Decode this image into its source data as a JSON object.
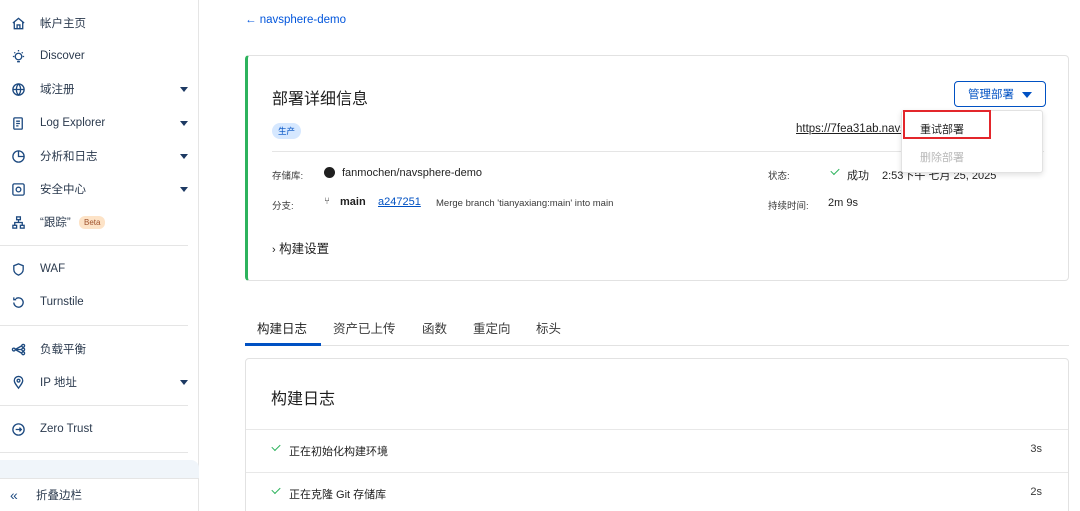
{
  "sidebar": {
    "items": [
      {
        "label": "帐户主页",
        "icon": "home-icon"
      },
      {
        "label": "Discover",
        "icon": "lightbulb-icon"
      },
      {
        "label": "域注册",
        "icon": "globe-icon"
      },
      {
        "label": "Log Explorer",
        "icon": "log-icon"
      },
      {
        "label": "分析和日志",
        "icon": "chart-pie-icon"
      },
      {
        "label": "安全中心",
        "icon": "security-icon"
      },
      {
        "label": "“跟踪”",
        "icon": "trace-icon",
        "badge": "Beta"
      },
      {
        "label": "WAF",
        "icon": "waf-shield-icon"
      },
      {
        "label": "Turnstile",
        "icon": "turnstile-icon"
      },
      {
        "label": "负载平衡",
        "icon": "load-balance-icon"
      },
      {
        "label": "IP 地址",
        "icon": "location-pin-icon"
      },
      {
        "label": "Zero Trust",
        "icon": "zero-trust-icon"
      }
    ],
    "collapse_label": "折叠边栏"
  },
  "breadcrumb": {
    "back_label": "← navsphere-demo"
  },
  "deployment": {
    "title": "部署详细信息",
    "environment_badge": "生产",
    "manage_button": "管理部署",
    "url": "https://7fea31ab.navsphere-demo.pages.dev",
    "repo_label": "存储库:",
    "repo_value": "fanmochen/navsphere-demo",
    "branch_label": "分支:",
    "branch_value": "main",
    "commit_hash": "a247251",
    "commit_message": "Merge branch 'tianyaxiang:main' into main",
    "status_label": "状态:",
    "status_value": "成功",
    "status_time": "2:53下午 七月 25, 2025",
    "duration_label": "持续时间:",
    "duration_value": "2m 9s",
    "build_settings": "构建设置"
  },
  "dropdown": {
    "retry": "重试部署",
    "delete": "删除部署"
  },
  "tabs": [
    {
      "label": "构建日志",
      "active": true
    },
    {
      "label": "资产已上传"
    },
    {
      "label": "函数"
    },
    {
      "label": "重定向"
    },
    {
      "label": "标头"
    }
  ],
  "build_log": {
    "title": "构建日志",
    "rows": [
      {
        "text": "正在初始化构建环境",
        "time": "3s"
      },
      {
        "text": "正在克隆 Git 存储库",
        "time": "2s"
      }
    ]
  },
  "colors": {
    "accent": "#0051c3",
    "success": "#2db35d",
    "highlight": "#e3262b"
  }
}
